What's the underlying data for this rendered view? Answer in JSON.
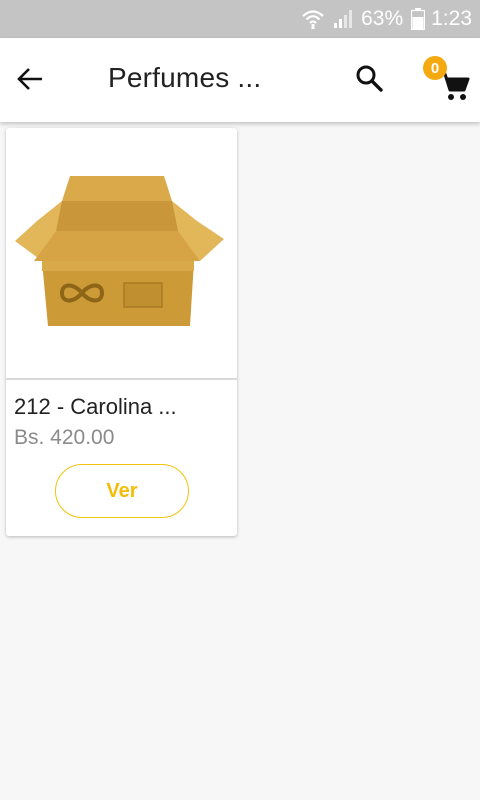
{
  "status_bar": {
    "battery": "63%",
    "time": "1:23",
    "icons": [
      "wifi-icon",
      "signal-icon",
      "battery-icon"
    ]
  },
  "app_bar": {
    "title": "Perfumes ...",
    "back_icon": "arrow-left-icon",
    "search_icon": "search-icon",
    "cart_icon": "cart-icon",
    "cart_count": "0"
  },
  "products": [
    {
      "name": "212 - Carolina ...",
      "price": "Bs. 420.00",
      "image_icon": "package-box-icon",
      "button_label": "Ver"
    }
  ],
  "colors": {
    "status_bar_bg": "#c4c4c4",
    "accent": "#f3c20c",
    "badge": "#f4a90f",
    "background": "#f7f7f7"
  }
}
